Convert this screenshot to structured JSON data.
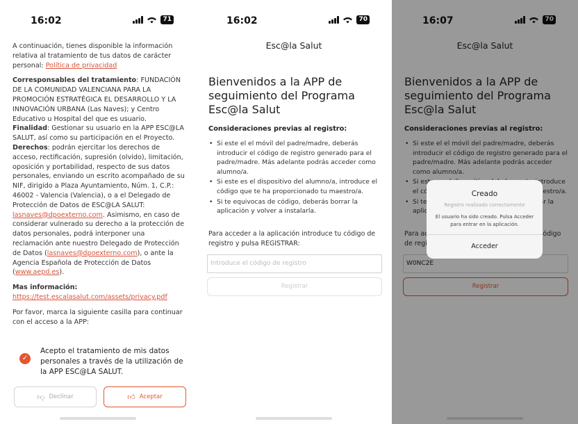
{
  "status": {
    "time1": "16:02",
    "time2": "16:02",
    "time3": "16:07",
    "battery1": "71",
    "battery2": "70",
    "battery3": "70"
  },
  "screen1": {
    "intro": "A continuación, tienes disponible la información relativa al tratamiento de tus datos de carácter personal: ",
    "intro_link": "Política de privacidad",
    "resp_label": "Corresponsables del tratamiento",
    "resp_text": ": FUNDACIÓN DE LA COMUNIDAD VALENCIANA PARA LA PROMOCIÓN ESTRATÉGICA EL DESARROLLO Y LA INNOVACIÓN URBANA (Las Naves); y Centro Educativo u Hospital del que es usuario.",
    "fin_label": "Finalidad",
    "fin_text": ": Gestionar su usuario en la APP ESC@LA SALUT, así como su participación en el Proyecto.",
    "der_label": "Derechos",
    "der_text": ": podrán ejercitar los derechos de acceso, rectificación, supresión (olvido), limitación, oposición y portabilidad, respecto de sus datos personales, enviando un escrito acompañado de su NIF, dirigido a Plaza Ayuntamiento, Núm. 1, C.P.: 46002 - Valencia (Valencia), o a el Delegado de Protección de Datos de ESC@LA SALUT: ",
    "der_link": "lasnaves@dpoexterno.com",
    "der_text2": ". Asimismo, en caso de considerar vulnerado su derecho a la protección de datos personales, podrá interponer una reclamación ante nuestro Delegado de Protección de Datos (",
    "der_link2": "lasnaves@dpoexterno.com",
    "der_text3": "), o ante la Agencia Española de Protección de Datos (",
    "der_link3": "www.aepd.es",
    "der_text4": ").",
    "more_label": "Mas información:",
    "more_link": "https://test.escalasalut.com/assets/privacy.pdf",
    "please": "Por favor, marca la siguiente casilla para continuar con el acceso a la APP:",
    "consent": "Acepto el tratamiento de mis datos personales a través de la utilización de la APP ESC@LA SALUT.",
    "decline_label": "Declinar",
    "accept_label": "Aceptar"
  },
  "screen2": {
    "app_title": "Esc@la Salut",
    "welcome": "Bienvenidos a la APP de seguimiento del Programa Esc@la Salut",
    "consid": "Consideraciones previas al registro:",
    "bullets": [
      "Si este el el móvil del padre/madre, deberás introducir el código de registro generado para el padre/madre. Más adelante podrás acceder como alumno/a.",
      "Si este es el dispositivo del alumno/a, introduce el código que te ha proporcionado tu maestro/a.",
      "Si te equivocas de código, deberás borrar la aplicación y volver a instalarla."
    ],
    "instr": "Para acceder a la aplicación introduce tu código de registro y pulsa REGISTRAR:",
    "input_placeholder": "Introduce el código de registro",
    "register_label": "Registrar"
  },
  "screen3": {
    "input_value": "W0NC2E",
    "alert_title": "Creado",
    "alert_sub": "Registro realizado correctamente",
    "alert_msg": "El usuario ha sido creado. Pulsa Acceder para entrar en la aplicación.",
    "alert_button": "Acceder"
  }
}
